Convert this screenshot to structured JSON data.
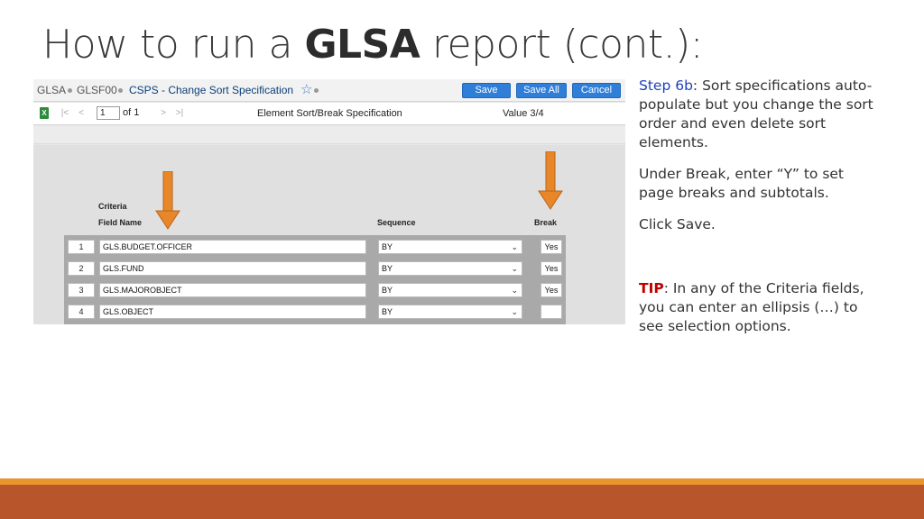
{
  "slide": {
    "title_before": "How to run a ",
    "title_bold": "GLSA",
    "title_after": " report (cont.):"
  },
  "app": {
    "breadcrumb": [
      "GLSA",
      "GLSF00",
      "CSPS - Change Sort Specification"
    ],
    "buttons": {
      "save": "Save",
      "save_all": "Save All",
      "cancel": "Cancel"
    },
    "toolbar": {
      "page_value": "1",
      "page_of": "of 1",
      "title": "Element Sort/Break Specification",
      "value": "Value 3/4"
    },
    "headers": {
      "criteria": "Criteria",
      "field_name": "Field Name",
      "sequence": "Sequence",
      "break": "Break"
    },
    "rows": [
      {
        "num": "1",
        "field": "GLS.BUDGET.OFFICER",
        "sequence": "BY",
        "break": "Yes"
      },
      {
        "num": "2",
        "field": "GLS.FUND",
        "sequence": "BY",
        "break": "Yes"
      },
      {
        "num": "3",
        "field": "GLS.MAJOROBJECT",
        "sequence": "BY",
        "break": "Yes"
      },
      {
        "num": "4",
        "field": "GLS.OBJECT",
        "sequence": "BY",
        "break": ""
      }
    ],
    "colors": {
      "button": "#2f7fd9",
      "arrow": "#e8862a"
    }
  },
  "notes": {
    "step_label": "Step 6b",
    "step_text": ": Sort specifications auto-populate but you change the sort order and even delete sort elements.",
    "break_text": "Under Break, enter “Y” to set page breaks and subtotals.",
    "click_text": "Click Save.",
    "tip_label": "TIP",
    "tip_text": ": In any of the Criteria fields, you can enter an ellipsis (…) to see selection options."
  }
}
